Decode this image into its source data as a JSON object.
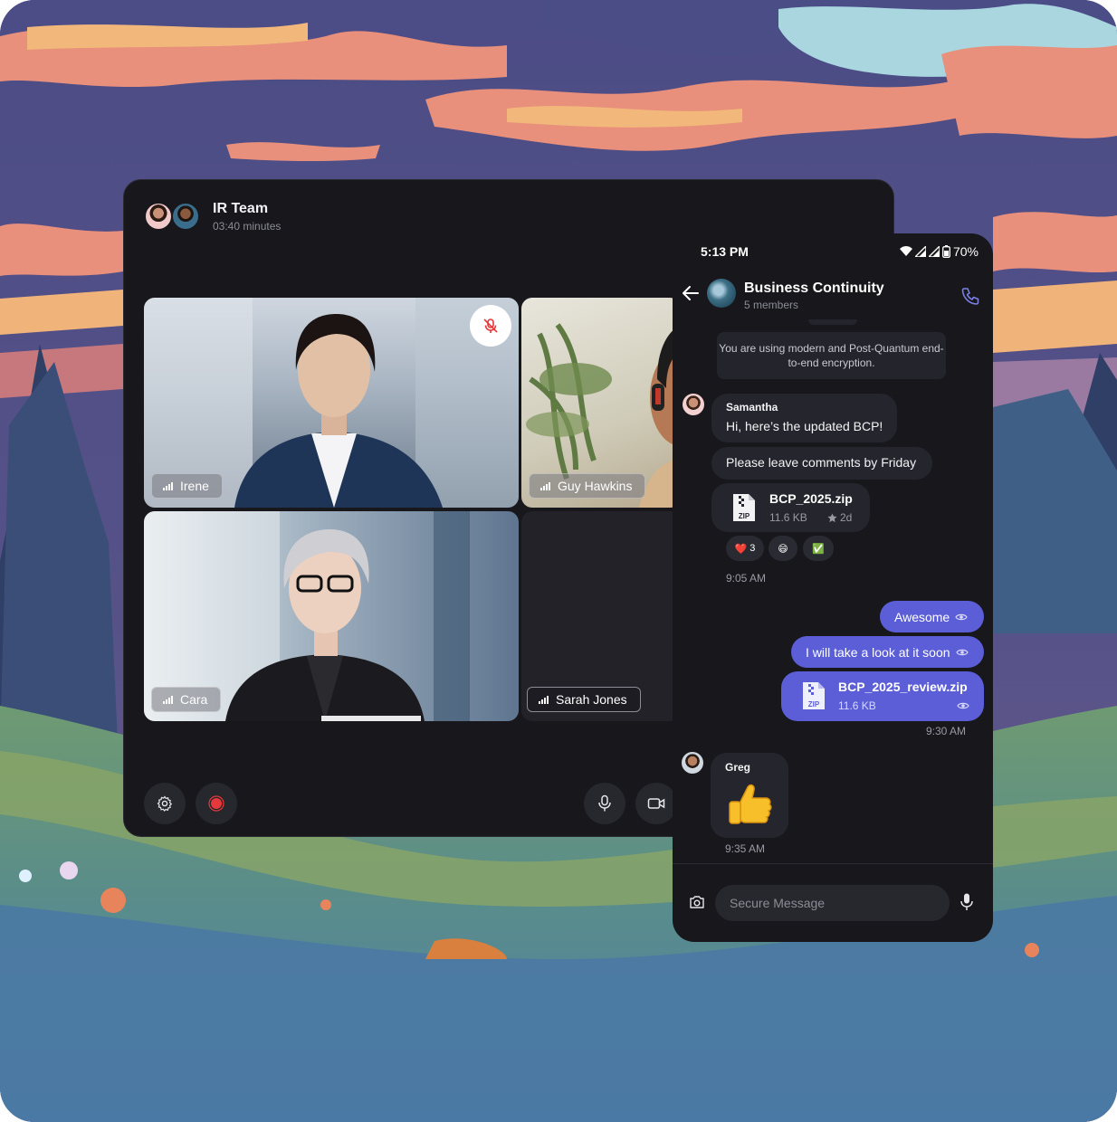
{
  "call": {
    "title": "IR Team",
    "duration": "03:40 minutes",
    "participants": [
      {
        "name": "Irene",
        "muted": true
      },
      {
        "name": "Guy Hawkins",
        "muted": false
      },
      {
        "name": "Cara",
        "muted": false
      },
      {
        "name": "Sarah Jones",
        "muted": false
      }
    ],
    "controls": {
      "settings": "gear-icon",
      "record": "record-icon",
      "mic": "mic-icon",
      "camera": "video-icon"
    }
  },
  "phone": {
    "status": {
      "time": "5:13 PM",
      "battery": "70%"
    },
    "chat": {
      "title": "Business Continuity",
      "subtitle": "5 members",
      "encryption_notice": "You are using modern and Post-Quantum end-to-end encryption."
    },
    "messages": {
      "samantha": {
        "sender": "Samantha",
        "text1": "Hi, here’s the updated BCP!",
        "text2": "Please leave comments by Friday",
        "file": {
          "name": "BCP_2025.zip",
          "size": "11.6 KB",
          "age": "2d",
          "type_label": "ZIP"
        },
        "reactions": [
          {
            "emoji": "❤️",
            "count": "3"
          },
          {
            "emoji": "😄",
            "count": ""
          },
          {
            "emoji": "✅",
            "count": ""
          }
        ],
        "time": "9:05 AM"
      },
      "mine": {
        "text1": "Awesome",
        "text2": "I will take a look at it soon",
        "file": {
          "name": "BCP_2025_review.zip",
          "size": "11.6 KB",
          "type_label": "ZIP"
        },
        "time": "9:30 AM"
      },
      "greg": {
        "sender": "Greg",
        "emoji": "👍",
        "time": "9:35 AM"
      }
    },
    "composer": {
      "placeholder": "Secure Message"
    }
  },
  "colors": {
    "accent": "#5b5ed6",
    "panel": "#17171c",
    "bubble": "#25252d",
    "record": "#e5383b"
  }
}
